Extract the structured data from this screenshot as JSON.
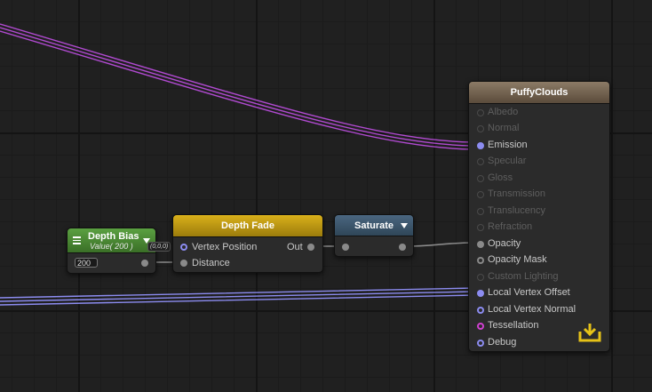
{
  "output_node": {
    "title": "PuffyClouds",
    "ports": [
      {
        "label": "Albedo",
        "state": "inactive"
      },
      {
        "label": "Normal",
        "state": "inactive"
      },
      {
        "label": "Emission",
        "state": "connected"
      },
      {
        "label": "Specular",
        "state": "inactive"
      },
      {
        "label": "Gloss",
        "state": "inactive"
      },
      {
        "label": "Transmission",
        "state": "inactive"
      },
      {
        "label": "Translucency",
        "state": "inactive"
      },
      {
        "label": "Refraction",
        "state": "inactive"
      },
      {
        "label": "Opacity",
        "state": "connected"
      },
      {
        "label": "Opacity Mask",
        "state": "available"
      },
      {
        "label": "Custom Lighting",
        "state": "inactive"
      },
      {
        "label": "Local Vertex Offset",
        "state": "connected"
      },
      {
        "label": "Local Vertex Normal",
        "state": "available"
      },
      {
        "label": "Tessellation",
        "state": "available"
      },
      {
        "label": "Debug",
        "state": "available"
      }
    ],
    "save_icon": "download-tray-icon"
  },
  "depth_fade_node": {
    "title": "Depth Fade",
    "inputs": [
      "Vertex Position",
      "Distance"
    ],
    "output": "Out"
  },
  "saturate_node": {
    "title": "Saturate"
  },
  "depth_bias_node": {
    "title": "Depth Bias",
    "subtitle": "Value( 200 )",
    "preview_value": "(0,0,0)",
    "value": "200"
  },
  "colors": {
    "canvas_bg": "#202020",
    "emission_wire": "#b04ad0",
    "vertex_offset_wire": "#8c8cf0",
    "float_wire": "#8a8a8a",
    "output_header": "#7a6a56",
    "depth_fade_header": "#c9a013",
    "saturate_header": "#3d566c",
    "depth_bias_header": "#4c8c36"
  }
}
